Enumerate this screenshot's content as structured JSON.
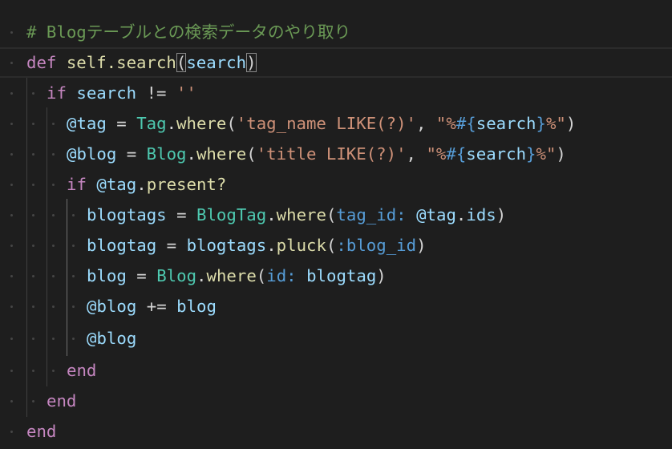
{
  "editor": {
    "language": "ruby",
    "theme_colors": {
      "background": "#1e1e1e",
      "comment": "#6a9955",
      "keyword": "#c586c0",
      "variable": "#9cdcfe",
      "class": "#4ec9b0",
      "function": "#dcdcaa",
      "string": "#ce9178",
      "symbol": "#569cd6",
      "default": "#d4d4d4"
    },
    "lines": {
      "l1": {
        "comment": "# Blogテーブルとの検索データのやり取り"
      },
      "l2": {
        "def": "def",
        "self_search": "self.search",
        "open": "(",
        "param": "search",
        "close": ")"
      },
      "l3": {
        "if": "if",
        "search": "search",
        "op": " != ",
        "str": "''"
      },
      "l4": {
        "ivar": "@tag",
        "eq": " = ",
        "cls": "Tag",
        "dot": ".",
        "fn": "where",
        "open": "(",
        "str1": "'tag_name LIKE(?)'",
        "comma": ", ",
        "str2a": "\"%",
        "itp_open": "#{",
        "itp_var": "search",
        "itp_close": "}",
        "str2b": "%\"",
        "close": ")"
      },
      "l5": {
        "ivar": "@blog",
        "eq": " = ",
        "cls": "Blog",
        "dot": ".",
        "fn": "where",
        "open": "(",
        "str1": "'title LIKE(?)'",
        "comma": ", ",
        "str2a": "\"%",
        "itp_open": "#{",
        "itp_var": "search",
        "itp_close": "}",
        "str2b": "%\"",
        "close": ")"
      },
      "l6": {
        "if": "if",
        "ivar": "@tag",
        "dot": ".",
        "fn": "present?"
      },
      "l7": {
        "var": "blogtags",
        "eq": " = ",
        "cls": "BlogTag",
        "dot": ".",
        "fn": "where",
        "open": "(",
        "sym": "tag_id:",
        "sp": " ",
        "ivar": "@tag",
        "dot2": ".",
        "fn2": "ids",
        "close": ")"
      },
      "l8": {
        "var": "blogtag",
        "eq": " = ",
        "var2": "blogtags",
        "dot": ".",
        "fn": "pluck",
        "open": "(",
        "sym": ":blog_id",
        "close": ")"
      },
      "l9": {
        "var": "blog",
        "eq": " = ",
        "cls": "Blog",
        "dot": ".",
        "fn": "where",
        "open": "(",
        "sym": "id:",
        "sp": " ",
        "var2": "blogtag",
        "close": ")"
      },
      "l10": {
        "ivar": "@blog",
        "op": " += ",
        "var": "blog"
      },
      "l11": {
        "ivar": "@blog"
      },
      "l12": {
        "end": "end"
      },
      "l13": {
        "end": "end"
      },
      "l14": {
        "end": "end"
      }
    }
  }
}
